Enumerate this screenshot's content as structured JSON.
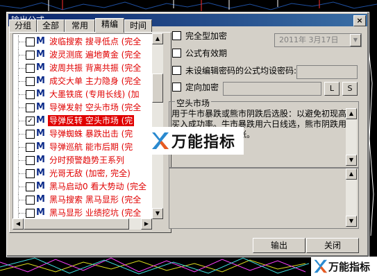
{
  "window": {
    "title": "输出公式",
    "close_glyph": "×"
  },
  "tabs": [
    "分组",
    "全部",
    "常用",
    "精编",
    "时间"
  ],
  "active_tab": 3,
  "formulas": [
    {
      "label": "波临搜索  搜寻低点 (完全",
      "checked": false,
      "selected": false
    },
    {
      "label": "波灵测底  遍地黄金 (完全",
      "checked": false,
      "selected": false
    },
    {
      "label": "波周共振  背离共振 (完全",
      "checked": false,
      "selected": false
    },
    {
      "label": "成交大单  主力隐身 (完全",
      "checked": false,
      "selected": false
    },
    {
      "label": "大墨铁底 (专用长线) (加",
      "checked": false,
      "selected": false
    },
    {
      "label": "导弹发射  空头市场 (完全",
      "checked": false,
      "selected": false
    },
    {
      "label": "导弹反转  空头市场 (完",
      "checked": true,
      "selected": true
    },
    {
      "label": "导弹蜘蛛  暴跌出击 (完",
      "checked": false,
      "selected": false
    },
    {
      "label": "导弹巡航  能市后期 (完",
      "checked": false,
      "selected": false
    },
    {
      "label": "分时预警趋势王系列",
      "checked": false,
      "selected": false
    },
    {
      "label": "光哥无敌 (加密, 完全)",
      "checked": false,
      "selected": false
    },
    {
      "label": "黑马启动0  看大势动 (完全",
      "checked": false,
      "selected": false
    },
    {
      "label": "黑马搜索  黑马显形 (完全",
      "checked": false,
      "selected": false
    },
    {
      "label": "黑马显形  业绩挖坑 (完全",
      "checked": false,
      "selected": false
    }
  ],
  "options": {
    "full_encrypt": "完全型加密",
    "expiry": "公式有效期",
    "expiry_date": "2011年 3月17日",
    "set_password": "未设编辑密码的公式均设密码:",
    "target_encrypt": "定向加密",
    "btn_l": "L",
    "btn_s": "S"
  },
  "group": {
    "title": "空头市场",
    "description": "用于牛市暴跌或熊市阴跌后选股：以避免初现高买入成功率。牛市暴跌用六日线选，熊市阴跌用日线选，切记不追涨。"
  },
  "buttons": {
    "export": "输出",
    "close": "关闭"
  },
  "watermark": {
    "text": "万能指标"
  },
  "icons": {
    "formula": "M"
  }
}
